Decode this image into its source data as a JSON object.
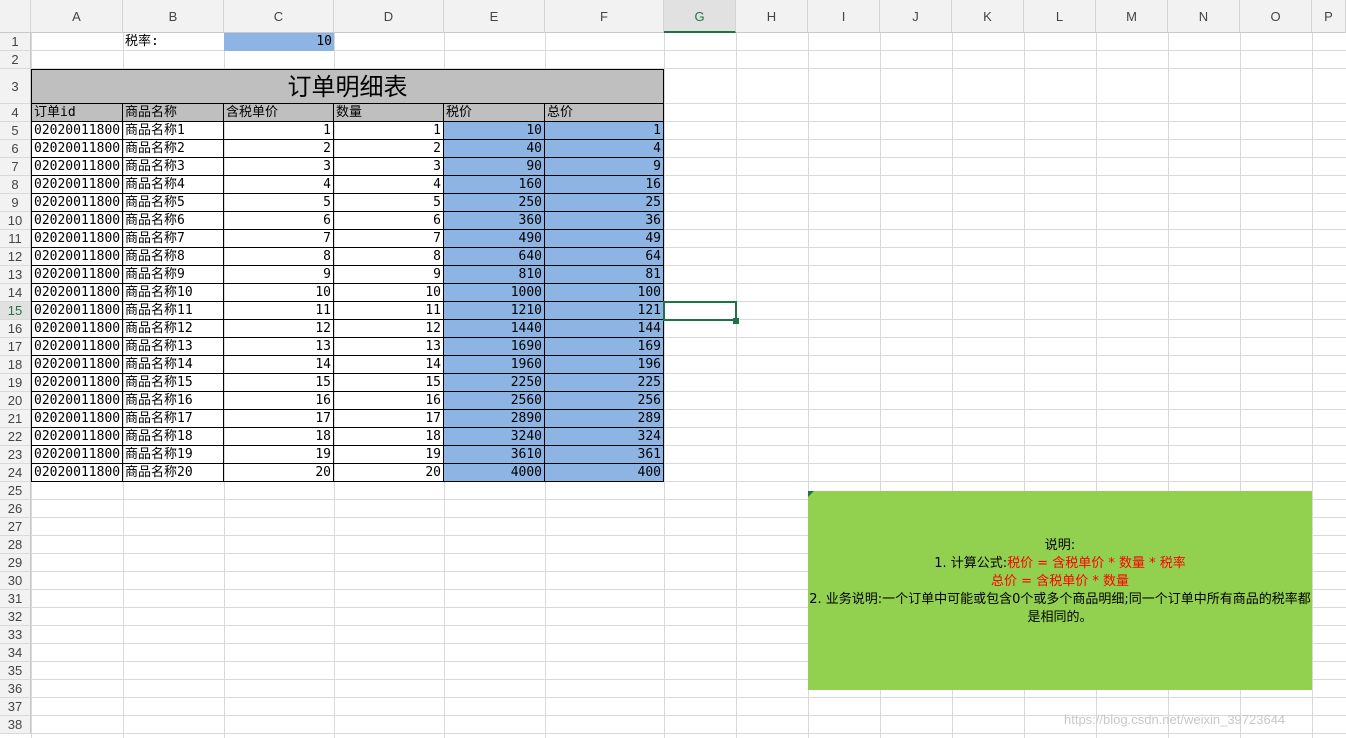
{
  "sheet": {
    "columns": [
      "A",
      "B",
      "C",
      "D",
      "E",
      "F",
      "G",
      "H",
      "I",
      "J",
      "K",
      "L",
      "M",
      "N",
      "O"
    ],
    "selected_column": "G",
    "selected_row": 15,
    "row_numbers": [
      1,
      2,
      3,
      4,
      5,
      6,
      7,
      8,
      9,
      10,
      11,
      12,
      13,
      14,
      15,
      16,
      17,
      18,
      19,
      20,
      21,
      22,
      23,
      24,
      25,
      26,
      27,
      28,
      29,
      30,
      31,
      32,
      33,
      34,
      35,
      36,
      37,
      38
    ],
    "tax_label": "税率:",
    "tax_value": "10",
    "table_title": "订单明细表",
    "headers": [
      "订单id",
      "商品名称",
      "含税单价",
      "数量",
      "税价",
      "总价"
    ],
    "rows": [
      [
        "02020011800",
        "商品名称1",
        "1",
        "1",
        "10",
        "1"
      ],
      [
        "02020011800",
        "商品名称2",
        "2",
        "2",
        "40",
        "4"
      ],
      [
        "02020011800",
        "商品名称3",
        "3",
        "3",
        "90",
        "9"
      ],
      [
        "02020011800",
        "商品名称4",
        "4",
        "4",
        "160",
        "16"
      ],
      [
        "02020011800",
        "商品名称5",
        "5",
        "5",
        "250",
        "25"
      ],
      [
        "02020011800",
        "商品名称6",
        "6",
        "6",
        "360",
        "36"
      ],
      [
        "02020011800",
        "商品名称7",
        "7",
        "7",
        "490",
        "49"
      ],
      [
        "02020011800",
        "商品名称8",
        "8",
        "8",
        "640",
        "64"
      ],
      [
        "02020011800",
        "商品名称9",
        "9",
        "9",
        "810",
        "81"
      ],
      [
        "02020011800",
        "商品名称10",
        "10",
        "10",
        "1000",
        "100"
      ],
      [
        "02020011800",
        "商品名称11",
        "11",
        "11",
        "1210",
        "121"
      ],
      [
        "02020011800",
        "商品名称12",
        "12",
        "12",
        "1440",
        "144"
      ],
      [
        "02020011800",
        "商品名称13",
        "13",
        "13",
        "1690",
        "169"
      ],
      [
        "02020011800",
        "商品名称14",
        "14",
        "14",
        "1960",
        "196"
      ],
      [
        "02020011800",
        "商品名称15",
        "15",
        "15",
        "2250",
        "225"
      ],
      [
        "02020011800",
        "商品名称16",
        "16",
        "16",
        "2560",
        "256"
      ],
      [
        "02020011800",
        "商品名称17",
        "17",
        "17",
        "2890",
        "289"
      ],
      [
        "02020011800",
        "商品名称18",
        "18",
        "18",
        "3240",
        "324"
      ],
      [
        "02020011800",
        "商品名称19",
        "19",
        "19",
        "3610",
        "361"
      ],
      [
        "02020011800",
        "商品名称20",
        "20",
        "20",
        "4000",
        "400"
      ]
    ]
  },
  "note": {
    "heading": "说明:",
    "line1_prefix": "1. 计算公式:",
    "line1_formula": "税价 = 含税单价 * 数量 * 税率",
    "line2_formula": "总价 = 含税单价 * 数量",
    "line3": "2. 业务说明:一个订单中可能或包含0个或多个商品明细;同一个订单中所有商品的税率都是相同的。"
  },
  "watermark": "https://blog.csdn.net/weixin_39723644",
  "colors": {
    "header_fill": "#bfbfbf",
    "computed_fill": "#8eb4e3",
    "note_fill": "#92d050",
    "formula_red": "#ff0000",
    "selection_green": "#217346"
  }
}
